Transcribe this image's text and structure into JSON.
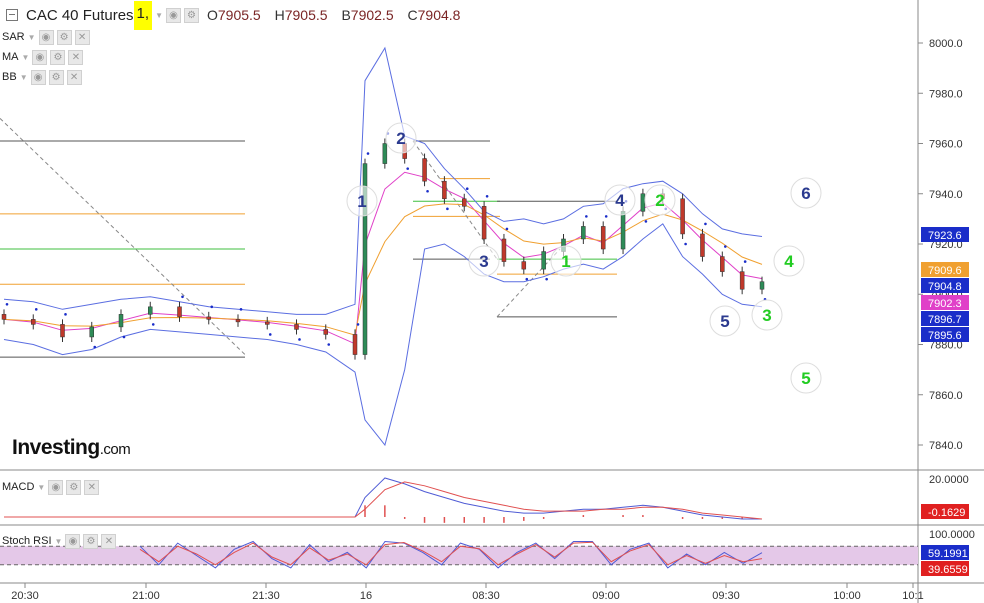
{
  "header": {
    "symbol": "CAC 40 Futures",
    "timeframe": "1,",
    "open_label": "O",
    "open": "7905.5",
    "high_label": "H",
    "high": "7905.5",
    "low_label": "B",
    "low": "7902.5",
    "close_label": "C",
    "close": "7904.8"
  },
  "indicators": [
    "SAR",
    "MA",
    "BB"
  ],
  "brand": {
    "name": "Investing",
    "suffix": ".com"
  },
  "macd_label": "MACD",
  "stoch_label": "Stoch RSI",
  "colors": {
    "candle_up": "#2e8b57",
    "candle_down": "#c0392b",
    "bollinger": "#5b6ee1",
    "sar": "#1a2dc9",
    "ma_fast": "#e040c8",
    "ma_slow": "#f0a030",
    "macd": "#4f5bd5",
    "signal": "#e05050",
    "stoch_band": "#e4c8e8",
    "wave_blue": "#2b3a8f",
    "wave_green": "#22cc22"
  },
  "chart_data": [
    {
      "type": "line",
      "title": "CAC 40 Futures, 1",
      "ylim": [
        7830,
        8008
      ],
      "y_ticks": [
        "8000.0",
        "7980.0",
        "7960.0",
        "7940.0",
        "7920.0",
        "7900.0",
        "7880.0",
        "7860.0",
        "7840.0"
      ],
      "x_ticks": [
        "20:30",
        "21:00",
        "21:30",
        "16",
        "08:30",
        "09:00",
        "09:30",
        "10:00",
        "10:1"
      ],
      "price_labels": [
        {
          "value": "7923.6",
          "color": "#1a2dc9"
        },
        {
          "value": "7909.6",
          "color": "#f0a030"
        },
        {
          "value": "7904.8",
          "color": "#1a2dc9"
        },
        {
          "value": "7902.3",
          "color": "#e040c8"
        },
        {
          "value": "7896.7",
          "color": "#1a2dc9"
        },
        {
          "value": "7895.6",
          "color": "#1a2dc9"
        }
      ],
      "horizontal_levels": [
        {
          "value": 7961,
          "color": "#555555"
        },
        {
          "value": 7932,
          "color": "#f0a030"
        },
        {
          "value": 7918,
          "color": "#3fbf3f"
        },
        {
          "value": 7904,
          "color": "#f0a030"
        },
        {
          "value": 7875,
          "color": "#555555"
        }
      ],
      "series": [
        {
          "name": "Close",
          "values": [
            7890,
            7888,
            7883,
            7887,
            7892,
            7895,
            7891,
            7890,
            7889,
            7888,
            7886,
            7884,
            7876,
            7952,
            7960,
            7954,
            7945,
            7938,
            7935,
            7922,
            7913,
            7910,
            7917,
            7922,
            7927,
            7918,
            7933,
            7940,
            7938,
            7924,
            7915,
            7909,
            7902,
            7905
          ]
        },
        {
          "name": "BB upper",
          "values": [
            7898,
            7897,
            7894,
            7896,
            7898,
            7899,
            7897,
            7895,
            7894,
            7893,
            7892,
            7892,
            7896,
            7985,
            7998,
            7963,
            7960,
            7950,
            7942,
            7933,
            7929,
            7930,
            7928,
            7930,
            7935,
            7936,
            7942,
            7944,
            7945,
            7940,
            7932,
            7926,
            7924,
            7923
          ]
        },
        {
          "name": "BB lower",
          "values": [
            7882,
            7880,
            7876,
            7878,
            7883,
            7886,
            7885,
            7884,
            7883,
            7882,
            7880,
            7877,
            7869,
            7850,
            7840,
            7870,
            7918,
            7920,
            7915,
            7908,
            7905,
            7905,
            7907,
            7910,
            7912,
            7910,
            7915,
            7922,
            7928,
            7915,
            7908,
            7900,
            7896,
            7895
          ]
        }
      ],
      "wave_labels": [
        {
          "label": "1",
          "color": "#2b3a8f"
        },
        {
          "label": "2",
          "color": "#2b3a8f"
        },
        {
          "label": "3",
          "color": "#2b3a8f"
        },
        {
          "label": "1",
          "color": "#22cc22"
        },
        {
          "label": "4",
          "color": "#2b3a8f"
        },
        {
          "label": "2",
          "color": "#22cc22"
        },
        {
          "label": "6",
          "color": "#2b3a8f"
        },
        {
          "label": "4",
          "color": "#22cc22"
        },
        {
          "label": "5",
          "color": "#2b3a8f"
        },
        {
          "label": "3",
          "color": "#22cc22"
        },
        {
          "label": "5",
          "color": "#22cc22"
        }
      ]
    },
    {
      "type": "line",
      "title": "MACD",
      "y_ticks": [
        "20.0000",
        "-0.1629"
      ],
      "series": [
        {
          "name": "MACD",
          "values": [
            0,
            0,
            0,
            0,
            0,
            0,
            0,
            0,
            0,
            0,
            0,
            0,
            0,
            10,
            20,
            17,
            13,
            10,
            7,
            5,
            3,
            2,
            2,
            3,
            4,
            4,
            5,
            6,
            5,
            3,
            1,
            0,
            -1,
            -1
          ]
        },
        {
          "name": "Signal",
          "values": [
            0,
            0,
            0,
            0,
            0,
            0,
            0,
            0,
            0,
            0,
            0,
            0,
            0,
            4,
            14,
            18,
            16,
            13,
            10,
            8,
            6,
            4,
            3,
            3,
            3,
            4,
            4,
            5,
            5,
            4,
            2,
            1,
            0,
            -1
          ]
        }
      ]
    },
    {
      "type": "line",
      "title": "Stoch RSI",
      "y_ticks": [
        "100.0000",
        "59.1991",
        "39.6559"
      ],
      "band": [
        20,
        80
      ],
      "series": [
        {
          "name": "%K",
          "values": [
            80,
            20,
            90,
            50,
            10,
            70,
            95,
            40,
            10,
            85,
            30,
            60,
            10,
            95,
            90,
            60,
            20,
            90,
            70,
            10,
            60,
            90,
            40,
            95,
            95,
            20,
            70,
            90,
            10,
            55,
            20,
            60,
            25,
            59
          ]
        },
        {
          "name": "%D",
          "values": [
            70,
            30,
            80,
            55,
            20,
            60,
            90,
            45,
            20,
            75,
            35,
            55,
            20,
            85,
            92,
            65,
            30,
            80,
            72,
            20,
            55,
            85,
            45,
            90,
            93,
            30,
            65,
            85,
            20,
            50,
            25,
            50,
            30,
            40
          ]
        }
      ]
    }
  ]
}
